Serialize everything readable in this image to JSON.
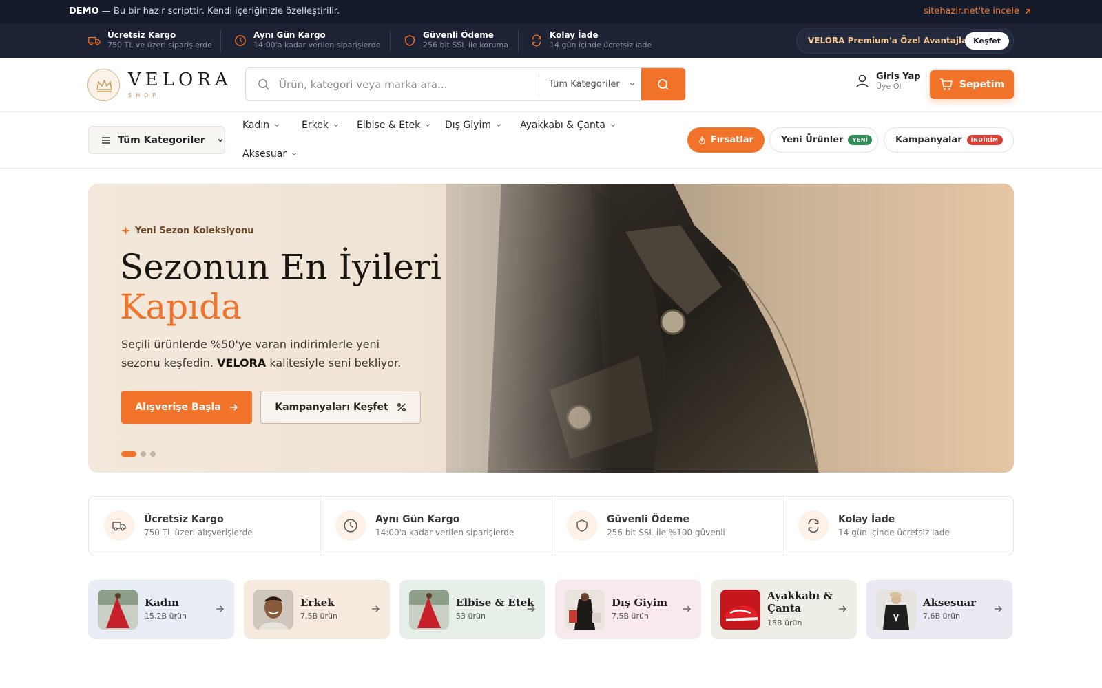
{
  "demo_bar": {
    "strong": "DEMO",
    "text": " — Bu bir hazır scripttir. Kendi içeriğinizle özelleştirilir.",
    "link": "sitehazir.net'te incele"
  },
  "perks": [
    {
      "title": "Ücretsiz Kargo",
      "sub": "750 TL ve üzeri siparişlerde",
      "icon": "truck-icon"
    },
    {
      "title": "Aynı Gün Kargo",
      "sub": "14:00'a kadar verilen siparişlerde",
      "icon": "clock-icon"
    },
    {
      "title": "Güvenli Ödeme",
      "sub": "256 bit SSL ile koruma",
      "icon": "shield-icon"
    },
    {
      "title": "Kolay İade",
      "sub": "14 gün içinde ücretsiz iade",
      "icon": "refresh-icon"
    }
  ],
  "premium": {
    "text": "VELORA Premium'a Özel Avantajlar",
    "button": "Keşfet"
  },
  "logo": {
    "name": "VELORA",
    "tag": "SHOP"
  },
  "search": {
    "placeholder": "Ürün, kategori veya marka ara...",
    "category": "Tüm Kategoriler"
  },
  "account": {
    "title": "Giriş Yap",
    "sub": "Üye Ol"
  },
  "cart": {
    "label": "Sepetim"
  },
  "nav": {
    "all_categories": "Tüm Kategoriler",
    "items": [
      "Kadın",
      "Erkek",
      "Elbise & Etek",
      "Dış Giyim",
      "Ayakkabı & Çanta",
      "Aksesuar"
    ],
    "deals": "Fırsatlar",
    "new_products": "Yeni Ürünler",
    "new_tag": "YENİ",
    "campaigns": "Kampanyalar",
    "campaign_tag": "İNDİRİM"
  },
  "hero": {
    "badge": "Yeni Sezon Koleksiyonu",
    "title_line1": "Sezonun En İyileri",
    "title_line2": "Kapıda",
    "desc_before": "Seçili ürünlerde %50'ye varan indirimlerle yeni sezonu keşfedin. ",
    "desc_brand": "VELORA",
    "desc_after": " kalitesiyle seni bekliyor.",
    "btn_primary": "Alışverişe Başla",
    "btn_secondary": "Kampanyaları Keşfet",
    "slides": 3,
    "active_slide": 1
  },
  "features": [
    {
      "title": "Ücretsiz Kargo",
      "sub": "750 TL üzeri alışverişlerde",
      "icon": "truck-icon"
    },
    {
      "title": "Aynı Gün Kargo",
      "sub": "14:00'a kadar verilen siparişlerde",
      "icon": "clock-icon"
    },
    {
      "title": "Güvenli Ödeme",
      "sub": "256 bit SSL ile %100 güvenli",
      "icon": "shield-icon"
    },
    {
      "title": "Kolay İade",
      "sub": "14 gün içinde ücretsiz iade",
      "icon": "refresh-icon"
    }
  ],
  "categories": [
    {
      "name": "Kadın",
      "count": "15,2B ürün",
      "bg": "#e9edf5"
    },
    {
      "name": "Erkek",
      "count": "7,5B ürün",
      "bg": "#f6eadf"
    },
    {
      "name": "Elbise & Etek",
      "count": "53 ürün",
      "bg": "#e6efe8"
    },
    {
      "name": "Dış Giyim",
      "count": "7,5B ürün",
      "bg": "#f7e9ec"
    },
    {
      "name": "Ayakkabı & Çanta",
      "count": "15B ürün",
      "bg": "#efeee6"
    },
    {
      "name": "Aksesuar",
      "count": "7,6B ürün",
      "bg": "#ebeaf3"
    }
  ],
  "colors": {
    "accent": "#f07329",
    "dark": "#151a2b"
  }
}
